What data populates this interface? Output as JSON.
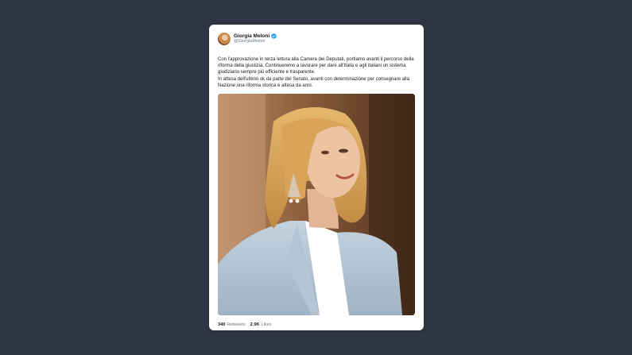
{
  "tweet": {
    "author_name": "Giorgia Meloni",
    "author_handle": "@GiorgiaMeloni",
    "text": "Con l'approvazione in terza lettura alla Camera dei Deputati, portiamo avanti il percorso della riforma della giustizia. Continueremo a lavorare per dare all'Italia e agli italiani un sistema giudiziario sempre più efficiente e trasparente.\nIn attesa dell'ultimo ok da parte del Senato, avanti con determinazione per consegnare alla Nazione una riforma storica e attesa da anni.",
    "retweets_count": "340",
    "retweets_label": "Retweets",
    "likes_count": "2.9K",
    "likes_label": "Likes"
  },
  "colors": {
    "background": "#2f3542",
    "card": "#ffffff",
    "verified": "#1da1f2",
    "secondary_text": "#657786"
  },
  "icons": {
    "verified": "verified-badge-icon"
  }
}
